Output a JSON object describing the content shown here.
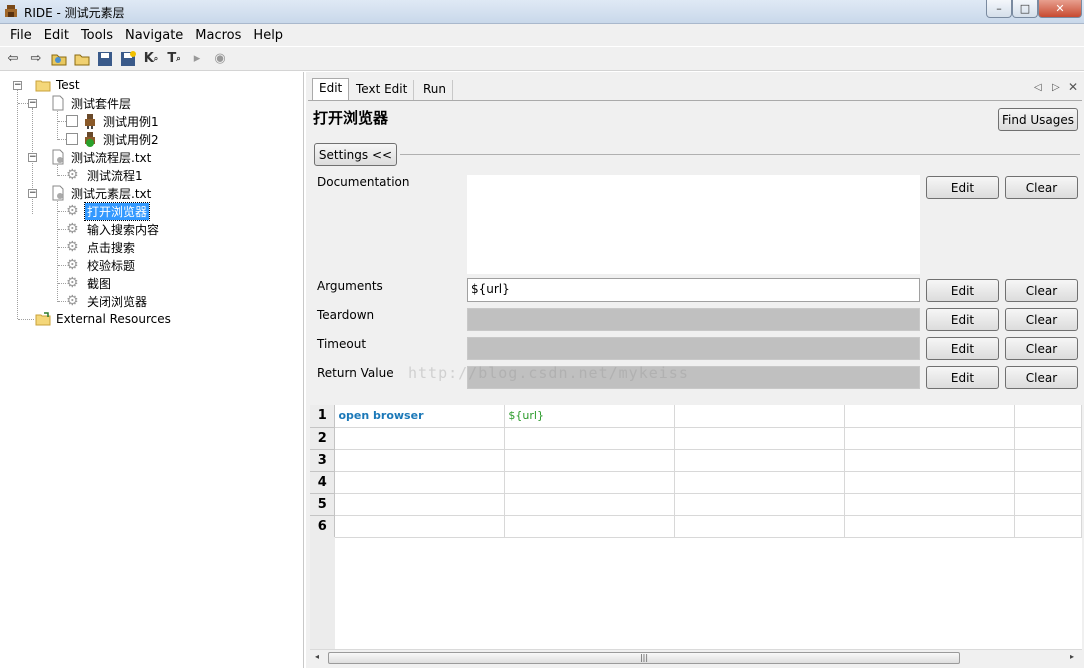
{
  "window": {
    "title": "RIDE - 测试元素层"
  },
  "menu": [
    "File",
    "Edit",
    "Tools",
    "Navigate",
    "Macros",
    "Help"
  ],
  "tree": {
    "root": "Test",
    "suite_layer": "测试套件层",
    "case1": "测试用例1",
    "case2": "测试用例2",
    "flow_file": "测试流程层.txt",
    "flow1": "测试流程1",
    "element_file": "测试元素层.txt",
    "kw_open": "打开浏览器",
    "kw_input": "输入搜索内容",
    "kw_click": "点击搜索",
    "kw_check": "校验标题",
    "kw_screenshot": "截图",
    "kw_close": "关闭浏览器",
    "external": "External Resources"
  },
  "tabs": {
    "edit": "Edit",
    "text_edit": "Text Edit",
    "run": "Run"
  },
  "editor": {
    "keyword_name": "打开浏览器",
    "find_usages": "Find Usages",
    "settings_toggle": "Settings <<",
    "edit_label": "Edit",
    "clear_label": "Clear",
    "documentation_label": "Documentation",
    "arguments_label": "Arguments",
    "arguments_value": "${url}",
    "teardown_label": "Teardown",
    "timeout_label": "Timeout",
    "return_label": "Return Value"
  },
  "watermark": "http://blog.csdn.net/mykeiss",
  "grid": {
    "rows": [
      "1",
      "2",
      "3",
      "4",
      "5",
      "6"
    ],
    "row1_keyword": "open browser",
    "row1_arg": "${url}"
  },
  "colors": {
    "selection": "#3399ff",
    "keyword": "#1b78b8",
    "argument": "#2a9a2a"
  }
}
